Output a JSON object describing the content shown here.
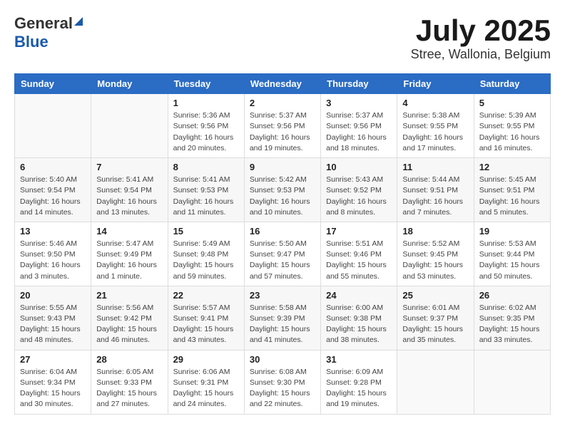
{
  "header": {
    "logo_general": "General",
    "logo_blue": "Blue",
    "month_title": "July 2025",
    "location": "Stree, Wallonia, Belgium"
  },
  "weekdays": [
    "Sunday",
    "Monday",
    "Tuesday",
    "Wednesday",
    "Thursday",
    "Friday",
    "Saturday"
  ],
  "weeks": [
    [
      {
        "day": "",
        "content": ""
      },
      {
        "day": "",
        "content": ""
      },
      {
        "day": "1",
        "content": "Sunrise: 5:36 AM\nSunset: 9:56 PM\nDaylight: 16 hours\nand 20 minutes."
      },
      {
        "day": "2",
        "content": "Sunrise: 5:37 AM\nSunset: 9:56 PM\nDaylight: 16 hours\nand 19 minutes."
      },
      {
        "day": "3",
        "content": "Sunrise: 5:37 AM\nSunset: 9:56 PM\nDaylight: 16 hours\nand 18 minutes."
      },
      {
        "day": "4",
        "content": "Sunrise: 5:38 AM\nSunset: 9:55 PM\nDaylight: 16 hours\nand 17 minutes."
      },
      {
        "day": "5",
        "content": "Sunrise: 5:39 AM\nSunset: 9:55 PM\nDaylight: 16 hours\nand 16 minutes."
      }
    ],
    [
      {
        "day": "6",
        "content": "Sunrise: 5:40 AM\nSunset: 9:54 PM\nDaylight: 16 hours\nand 14 minutes."
      },
      {
        "day": "7",
        "content": "Sunrise: 5:41 AM\nSunset: 9:54 PM\nDaylight: 16 hours\nand 13 minutes."
      },
      {
        "day": "8",
        "content": "Sunrise: 5:41 AM\nSunset: 9:53 PM\nDaylight: 16 hours\nand 11 minutes."
      },
      {
        "day": "9",
        "content": "Sunrise: 5:42 AM\nSunset: 9:53 PM\nDaylight: 16 hours\nand 10 minutes."
      },
      {
        "day": "10",
        "content": "Sunrise: 5:43 AM\nSunset: 9:52 PM\nDaylight: 16 hours\nand 8 minutes."
      },
      {
        "day": "11",
        "content": "Sunrise: 5:44 AM\nSunset: 9:51 PM\nDaylight: 16 hours\nand 7 minutes."
      },
      {
        "day": "12",
        "content": "Sunrise: 5:45 AM\nSunset: 9:51 PM\nDaylight: 16 hours\nand 5 minutes."
      }
    ],
    [
      {
        "day": "13",
        "content": "Sunrise: 5:46 AM\nSunset: 9:50 PM\nDaylight: 16 hours\nand 3 minutes."
      },
      {
        "day": "14",
        "content": "Sunrise: 5:47 AM\nSunset: 9:49 PM\nDaylight: 16 hours\nand 1 minute."
      },
      {
        "day": "15",
        "content": "Sunrise: 5:49 AM\nSunset: 9:48 PM\nDaylight: 15 hours\nand 59 minutes."
      },
      {
        "day": "16",
        "content": "Sunrise: 5:50 AM\nSunset: 9:47 PM\nDaylight: 15 hours\nand 57 minutes."
      },
      {
        "day": "17",
        "content": "Sunrise: 5:51 AM\nSunset: 9:46 PM\nDaylight: 15 hours\nand 55 minutes."
      },
      {
        "day": "18",
        "content": "Sunrise: 5:52 AM\nSunset: 9:45 PM\nDaylight: 15 hours\nand 53 minutes."
      },
      {
        "day": "19",
        "content": "Sunrise: 5:53 AM\nSunset: 9:44 PM\nDaylight: 15 hours\nand 50 minutes."
      }
    ],
    [
      {
        "day": "20",
        "content": "Sunrise: 5:55 AM\nSunset: 9:43 PM\nDaylight: 15 hours\nand 48 minutes."
      },
      {
        "day": "21",
        "content": "Sunrise: 5:56 AM\nSunset: 9:42 PM\nDaylight: 15 hours\nand 46 minutes."
      },
      {
        "day": "22",
        "content": "Sunrise: 5:57 AM\nSunset: 9:41 PM\nDaylight: 15 hours\nand 43 minutes."
      },
      {
        "day": "23",
        "content": "Sunrise: 5:58 AM\nSunset: 9:39 PM\nDaylight: 15 hours\nand 41 minutes."
      },
      {
        "day": "24",
        "content": "Sunrise: 6:00 AM\nSunset: 9:38 PM\nDaylight: 15 hours\nand 38 minutes."
      },
      {
        "day": "25",
        "content": "Sunrise: 6:01 AM\nSunset: 9:37 PM\nDaylight: 15 hours\nand 35 minutes."
      },
      {
        "day": "26",
        "content": "Sunrise: 6:02 AM\nSunset: 9:35 PM\nDaylight: 15 hours\nand 33 minutes."
      }
    ],
    [
      {
        "day": "27",
        "content": "Sunrise: 6:04 AM\nSunset: 9:34 PM\nDaylight: 15 hours\nand 30 minutes."
      },
      {
        "day": "28",
        "content": "Sunrise: 6:05 AM\nSunset: 9:33 PM\nDaylight: 15 hours\nand 27 minutes."
      },
      {
        "day": "29",
        "content": "Sunrise: 6:06 AM\nSunset: 9:31 PM\nDaylight: 15 hours\nand 24 minutes."
      },
      {
        "day": "30",
        "content": "Sunrise: 6:08 AM\nSunset: 9:30 PM\nDaylight: 15 hours\nand 22 minutes."
      },
      {
        "day": "31",
        "content": "Sunrise: 6:09 AM\nSunset: 9:28 PM\nDaylight: 15 hours\nand 19 minutes."
      },
      {
        "day": "",
        "content": ""
      },
      {
        "day": "",
        "content": ""
      }
    ]
  ]
}
